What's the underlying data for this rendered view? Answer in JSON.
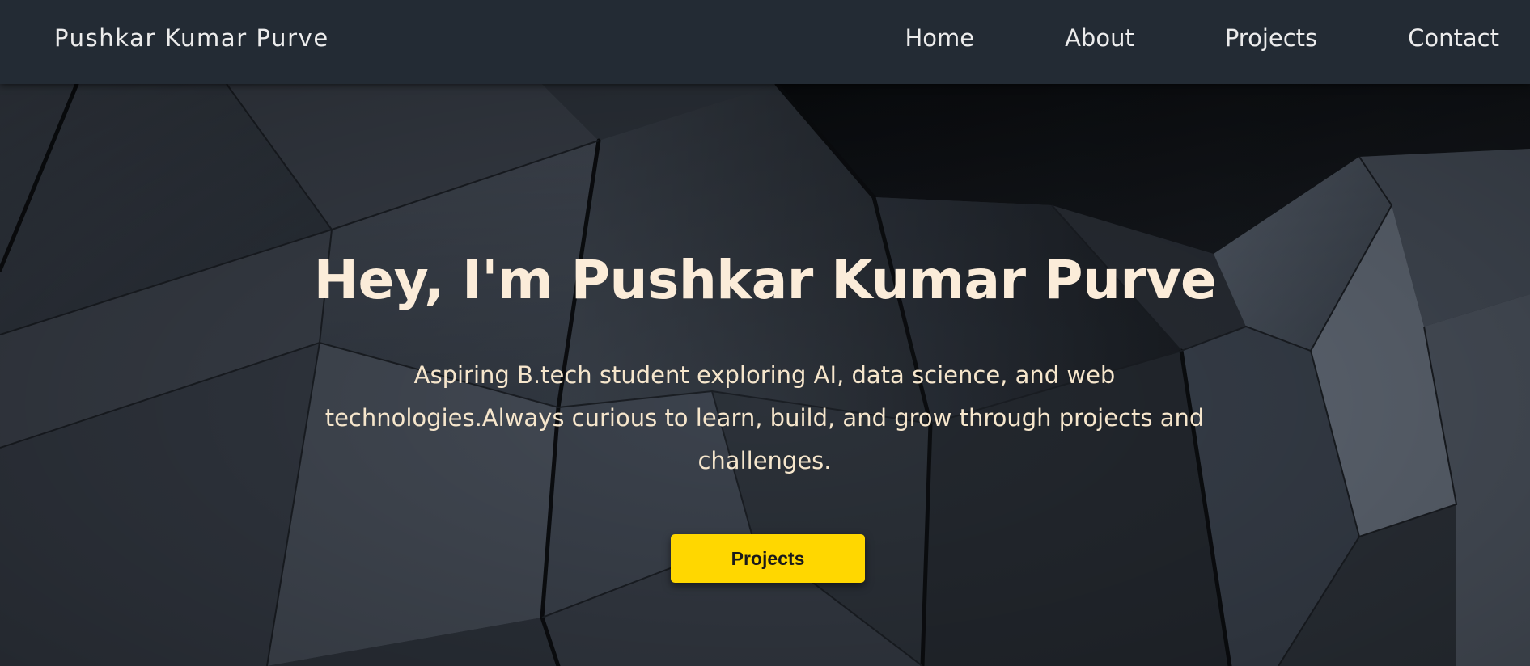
{
  "navbar": {
    "brand": "Pushkar Kumar Purve",
    "links": [
      {
        "label": "Home"
      },
      {
        "label": "About"
      },
      {
        "label": "Projects"
      },
      {
        "label": "Contact"
      }
    ]
  },
  "hero": {
    "title": "Hey, I'm Pushkar Kumar Purve",
    "subtitle": "Aspiring B.tech student exploring AI, data science, and web technologies.Always curious to learn, build, and grow through projects and challenges.",
    "button_label": "Projects"
  },
  "colors": {
    "navbar_bg": "#232b34",
    "title_color": "#fbecd9",
    "subtitle_color": "#f6e6cc",
    "accent_button": "#ffd700"
  }
}
